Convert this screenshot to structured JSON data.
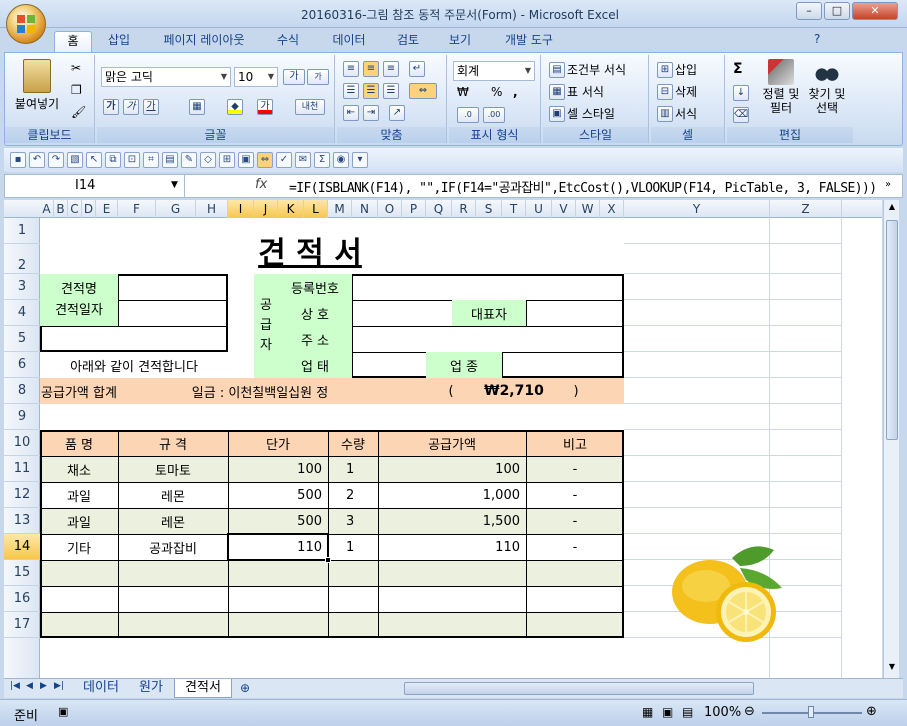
{
  "window": {
    "title": "20160316-그림 참조 동적 주문서(Form) - Microsoft Excel",
    "min": "–",
    "max": "□",
    "close": "✕"
  },
  "ribbon_tabs": [
    "홈",
    "삽입",
    "페이지 레이아웃",
    "수식",
    "데이터",
    "검토",
    "보기",
    "개발 도구"
  ],
  "ribbon": {
    "clipboard": {
      "paste": "붙여넣기",
      "label": "클립보드"
    },
    "font": {
      "name": "맑은 고딕",
      "size": "10",
      "label": "글꼴",
      "bold": "가",
      "italic": "가",
      "underline": "가",
      "grow": "가",
      "shrink": "가",
      "fontcolor": "가",
      "phonetic": "내천"
    },
    "align": {
      "label": "맞춤"
    },
    "number": {
      "format": "회계",
      "currency": "₩",
      "percent": "%",
      "comma": ",",
      "label": "표시 형식"
    },
    "style": {
      "conditional": "조건부 서식",
      "table": "표 서식",
      "cell": "셀 스타일",
      "label": "스타일"
    },
    "cells": {
      "insert": "삽입",
      "delete": "삭제",
      "format": "서식",
      "label": "셀"
    },
    "edit": {
      "sum": "Σ",
      "sort": "정렬 및 필터",
      "find": "찾기 및 선택",
      "label": "편집"
    }
  },
  "formula_bar": {
    "name_box": "I14",
    "fx": "fx",
    "formula": "=IF(ISBLANK(F14), \"\",IF(F14=\"공과잡비\",EtcCost(),VLOOKUP(F14, PicTable, 3, FALSE)))"
  },
  "columns": [
    "A",
    "B",
    "C",
    "D",
    "E",
    "F",
    "G",
    "H",
    "I",
    "J",
    "K",
    "L",
    "M",
    "N",
    "O",
    "P",
    "Q",
    "R",
    "S",
    "T",
    "U",
    "V",
    "W",
    "X",
    "Y",
    "Z"
  ],
  "rows": [
    "1",
    "2",
    "3",
    "4",
    "5",
    "6",
    "7",
    "8",
    "9",
    "10",
    "11",
    "12",
    "13",
    "14",
    "15",
    "16",
    "17"
  ],
  "sheet": {
    "title": "견   적   서",
    "estimate_name": "견적명",
    "estimate_date": "견적일자",
    "notice": "아래와 같이 견적합니다",
    "supplier": "공급자",
    "reg_no": "등록번호",
    "company": "상  호",
    "ceo": "대표자",
    "address": "주  소",
    "biz_type": "업  태",
    "biz_item": "업  종",
    "total_label": "공급가액 합계",
    "total_words": "일금 : 이천칠백일십원 정",
    "paren_open": "(",
    "total_amount": "₩2,710",
    "paren_close": ")",
    "headers": [
      "품      명",
      "규  격",
      "단가",
      "수량",
      "공급가액",
      "비고"
    ],
    "items": [
      {
        "name": "채소",
        "spec": "토마토",
        "price": "100",
        "qty": "1",
        "amount": "100",
        "note": "-"
      },
      {
        "name": "과일",
        "spec": "레몬",
        "price": "500",
        "qty": "2",
        "amount": "1,000",
        "note": "-"
      },
      {
        "name": "과일",
        "spec": "레몬",
        "price": "500",
        "qty": "3",
        "amount": "1,500",
        "note": "-"
      },
      {
        "name": "기타",
        "spec": "공과잡비",
        "price": "110",
        "qty": "1",
        "amount": "110",
        "note": "-"
      }
    ]
  },
  "sheet_tabs": [
    "데이터",
    "원가",
    "견적서"
  ],
  "status": {
    "ready": "준비",
    "zoom": "100%"
  },
  "colors": {
    "header_fill": "#fcd5b4",
    "row_alt": "#ebf1de",
    "label_fill": "#ccffcc",
    "selection": "#f8c64f"
  }
}
